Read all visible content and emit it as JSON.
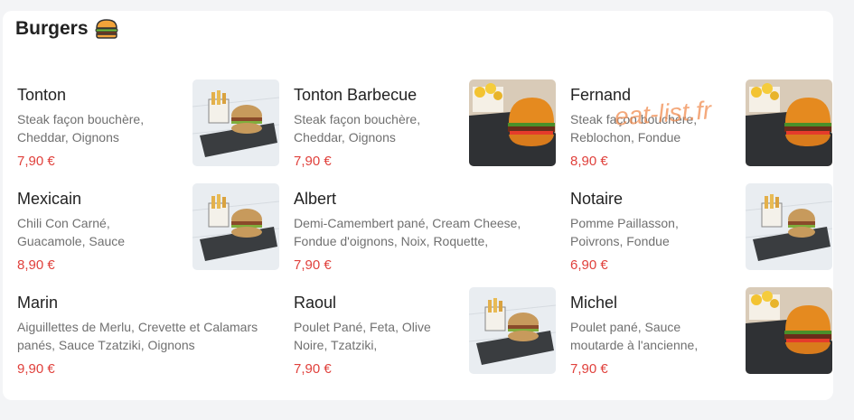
{
  "section": {
    "title": "Burgers",
    "emoji_icon": "burger-icon"
  },
  "watermark": "eat-list.fr",
  "items": [
    {
      "name": "Tonton",
      "desc": "Steak façon bouchère, Cheddar, Oignons",
      "price": "7,90 €",
      "image": "fries-burger-slate"
    },
    {
      "name": "Tonton Barbecue",
      "desc": "Steak façon bouchère, Cheddar, Oignons",
      "price": "7,90 €",
      "image": "fries-burger-brioche"
    },
    {
      "name": "Fernand",
      "desc": "Steak façon bouchère, Reblochon, Fondue",
      "price": "8,90 €",
      "image": "fries-burger-brioche"
    },
    {
      "name": "Mexicain",
      "desc": "Chili Con Carné, Guacamole, Sauce",
      "price": "8,90 €",
      "image": "fries-burger-slate"
    },
    {
      "name": "Albert",
      "desc": "Demi-Camembert pané, Cream Cheese, Fondue d'oignons, Noix, Roquette,",
      "price": "7,90 €",
      "image": null
    },
    {
      "name": "Notaire",
      "desc": "Pomme Paillasson, Poivrons, Fondue",
      "price": "6,90 €",
      "image": "fries-burger-slate"
    },
    {
      "name": "Marin",
      "desc": "Aiguillettes de Merlu, Crevette et Calamars panés, Sauce Tzatziki, Oignons",
      "price": "9,90 €",
      "image": null
    },
    {
      "name": "Raoul",
      "desc": "Poulet Pané, Feta, Olive Noire, Tzatziki,",
      "price": "7,90 €",
      "image": "fries-burger-slate"
    },
    {
      "name": "Michel",
      "desc": "Poulet pané, Sauce moutarde à l'ancienne,",
      "price": "7,90 €",
      "image": "fries-burger-brioche"
    }
  ]
}
